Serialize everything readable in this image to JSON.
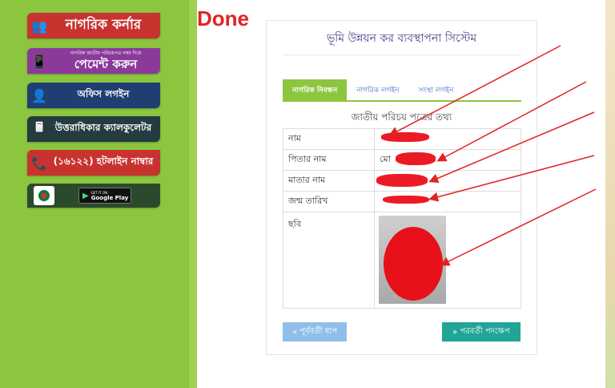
{
  "sidebar": {
    "corner_label": "নাগরিক কর্নার",
    "pay_small": "নাগরিক জাতীয় পরিচয়পত্র নম্বর দিয়ে",
    "pay_big": "পেমেন্ট করুন",
    "office_login": "অফিস লগইন",
    "calc_label": "উত্তরাধিকার ক্যালকুলেটর",
    "hotline_label": "(১৬১২২) হটলাইন নাম্বার",
    "gplay_top": "GET IT ON",
    "gplay_bottom": "Google Play"
  },
  "overlay": {
    "done_text": "Done"
  },
  "card": {
    "title": "ভূমি উন্নয়ন কর ব্যবস্থাপনা সিস্টেম",
    "tabs": [
      {
        "label": "নাগরিক নিবন্ধন",
        "active": true
      },
      {
        "label": "নাগরিক লগইন",
        "active": false
      },
      {
        "label": "সংস্থা লগইন",
        "active": false
      }
    ],
    "section_title": "জাতীয় পরিচয় পত্রের তথ্য",
    "rows": [
      {
        "key": "নাম",
        "value": ""
      },
      {
        "key": "পিতার নাম",
        "value": "মো"
      },
      {
        "key": "মাতার নাম",
        "value": ""
      },
      {
        "key": "জন্ম তারিখ",
        "value": ""
      },
      {
        "key": "ছবি",
        "value": ""
      }
    ],
    "prev_button": "পূর্ববর্তী ধাপ",
    "next_button": "পরবর্তী পদক্ষেপ"
  },
  "colors": {
    "sidebar_green": "#8cc63f",
    "annotation_red": "#e02424",
    "tab_active": "#8cc63f",
    "next_button": "#21a597",
    "prev_button": "#8fbfe9",
    "title_purple": "#4a3b8f"
  }
}
